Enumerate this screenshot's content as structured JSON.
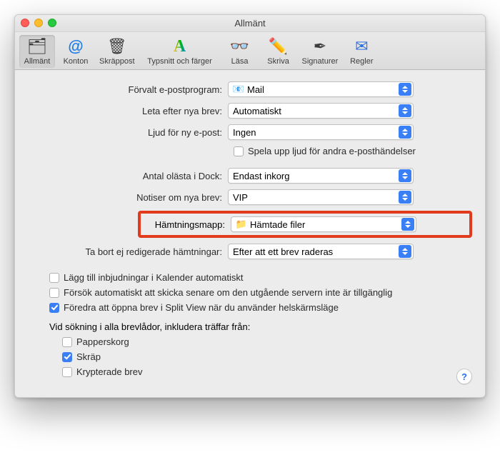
{
  "title": "Allmänt",
  "toolbar": [
    {
      "key": "general",
      "label": "Allmänt",
      "icon": "🗂"
    },
    {
      "key": "accounts",
      "label": "Konton",
      "icon": "@"
    },
    {
      "key": "junk",
      "label": "Skräppost",
      "icon": "🗑"
    },
    {
      "key": "fonts",
      "label": "Typsnitt och färger",
      "icon": "A"
    },
    {
      "key": "read",
      "label": "Läsa",
      "icon": "👓"
    },
    {
      "key": "write",
      "label": "Skriva",
      "icon": "✏️"
    },
    {
      "key": "sign",
      "label": "Signaturer",
      "icon": "✒︎"
    },
    {
      "key": "rules",
      "label": "Regler",
      "icon": "✉︎"
    }
  ],
  "fields": {
    "defaultClient": {
      "label": "Förvalt e-postprogram:",
      "value": "Mail"
    },
    "checkMail": {
      "label": "Leta efter nya brev:",
      "value": "Automatiskt"
    },
    "newMailSound": {
      "label": "Ljud för ny e-post:",
      "value": "Ingen"
    },
    "playOther": {
      "label": "Spela upp ljud för andra e-posthändelser",
      "checked": false
    },
    "dockUnread": {
      "label": "Antal olästa i Dock:",
      "value": "Endast inkorg"
    },
    "notifications": {
      "label": "Notiser om nya brev:",
      "value": "VIP"
    },
    "downloads": {
      "label": "Hämtningsmapp:",
      "value": "Hämtade filer"
    },
    "removeDl": {
      "label": "Ta bort ej redigerade hämtningar:",
      "value": "Efter att ett brev raderas"
    }
  },
  "options": {
    "calendarInvites": {
      "label": "Lägg till inbjudningar i Kalender automatiskt",
      "checked": false
    },
    "retrySend": {
      "label": "Försök automatiskt att skicka senare om den utgående servern inte är tillgänglig",
      "checked": false
    },
    "splitView": {
      "label": "Föredra att öppna brev i Split View när du använder helskärmsläge",
      "checked": true
    }
  },
  "search": {
    "heading": "Vid sökning i alla brevlådor, inkludera träffar från:",
    "trash": {
      "label": "Papperskorg",
      "checked": false
    },
    "junk": {
      "label": "Skräp",
      "checked": true
    },
    "encrypted": {
      "label": "Krypterade brev",
      "checked": false
    }
  },
  "help": "?"
}
